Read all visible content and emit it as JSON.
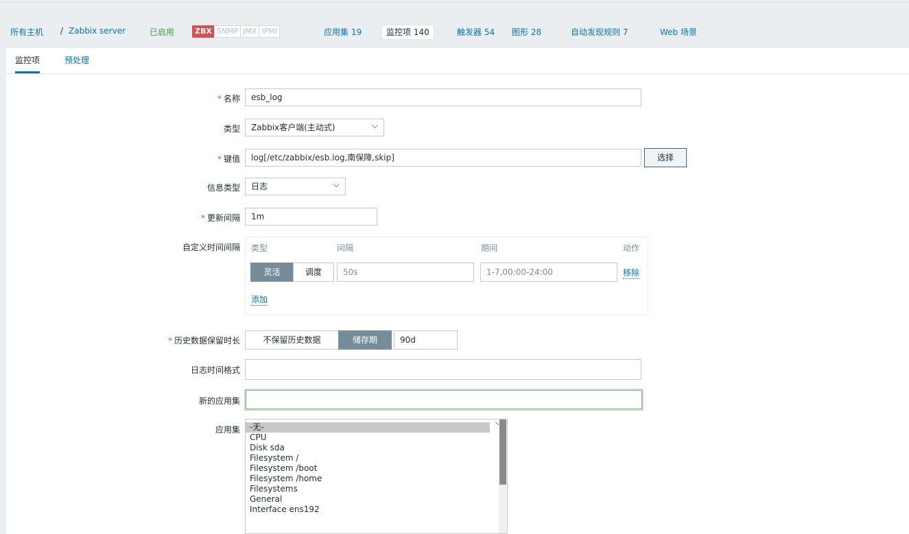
{
  "hostnav": {
    "all_hosts": "所有主机",
    "sep": "/",
    "host": "Zabbix server",
    "status": "已启用",
    "badges": [
      "ZBX",
      "SNMP",
      "JMX",
      "IPMI"
    ],
    "applications": "应用集 19",
    "items": "监控项 140",
    "triggers": "触发器 54",
    "graphs": "图形 28",
    "discovery": "自动发现规则 7",
    "web": "Web 场景"
  },
  "tabs": [
    "监控项",
    "预处理"
  ],
  "form": {
    "name_label": "名称",
    "name_value": "esb_log",
    "type_label": "类型",
    "type_value": "Zabbix客户端(主动式)",
    "key_label": "键值",
    "key_value": "log[/etc/zabbix/esb.log,南​​保障,skip]",
    "select_button": "选择",
    "info_type_label": "信息类型",
    "info_type_value": "日志",
    "interval_label": "更新间隔",
    "interval_value": "1m",
    "custom_label": "自定义时间间隔",
    "custom_headers": {
      "type": "类型",
      "interval": "间隔",
      "period": "期间",
      "action": "动作"
    },
    "custom_row": {
      "flexible": "灵活",
      "scheduling": "调度",
      "interval_placeholder": "50s",
      "period_placeholder": "1-7,00:00-24:00",
      "remove": "移除"
    },
    "add_link": "添加",
    "history_label": "历史数据保留时长",
    "history_no_keep": "不保留历史数据",
    "history_storage": "储存期",
    "history_value": "90d",
    "log_format_label": "日志时间格式",
    "log_format_value": "",
    "new_app_label": "新的应用集",
    "new_app_value": "",
    "apps_label": "应用集",
    "apps_options": [
      "-无-",
      "CPU",
      "Disk sda",
      "Filesystem /",
      "Filesystem /boot",
      "Filesystem /home",
      "Filesystems",
      "General",
      "Interface ens192"
    ]
  }
}
